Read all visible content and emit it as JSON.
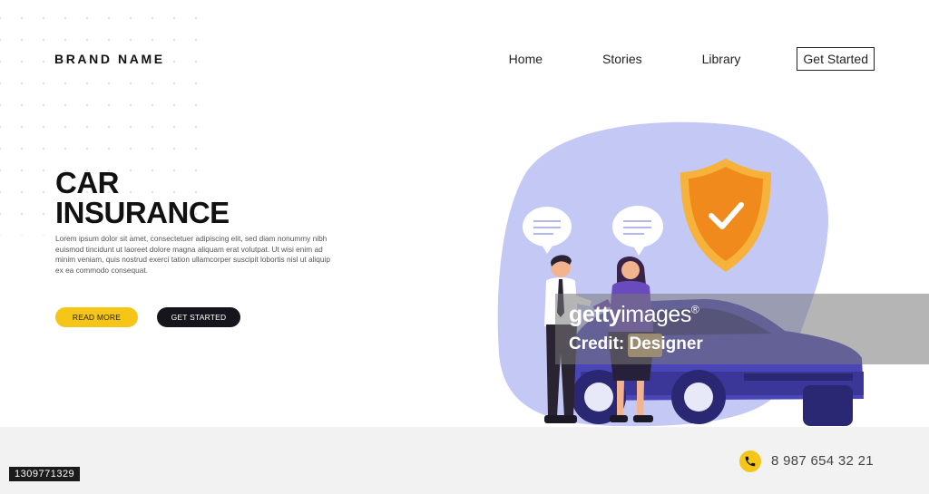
{
  "brand": {
    "name": "BRAND NAME"
  },
  "nav": {
    "links": [
      "Home",
      "Stories",
      "Library"
    ],
    "cta": "Get Started"
  },
  "hero": {
    "title_line1": "CAR",
    "title_line2": "INSURANCE",
    "body": "Lorem ipsum dolor sit amet, consectetuer adipiscing elit, sed diam nonummy nibh euismod tincidunt ut laoreet dolore magna aliquam erat volutpat. Ut wisi enim ad minim veniam, quis nostrud exerci tation ullamcorper suscipit lobortis nisl ut aliquip ex ea commodo consequat.",
    "read_more": "READ MORE",
    "get_started": "GET STARTED"
  },
  "illustration": {
    "icons": [
      "shield-check-icon",
      "speech-bubble-icon",
      "car"
    ]
  },
  "footer": {
    "phone_icon": "phone-icon",
    "phone": "8 987 654 32 21"
  },
  "watermark": {
    "logo_bold": "getty",
    "logo_light": "images",
    "logo_mark": "®",
    "credit": "Credit: Designer"
  },
  "image_id": "1309771329",
  "colors": {
    "accent_yellow": "#f5c518",
    "dark_button": "#16151c",
    "blob": "#c4c8f5",
    "shield": "#f08a1c",
    "car": "#4a46b8",
    "footer_bg": "#f2f2f2"
  }
}
